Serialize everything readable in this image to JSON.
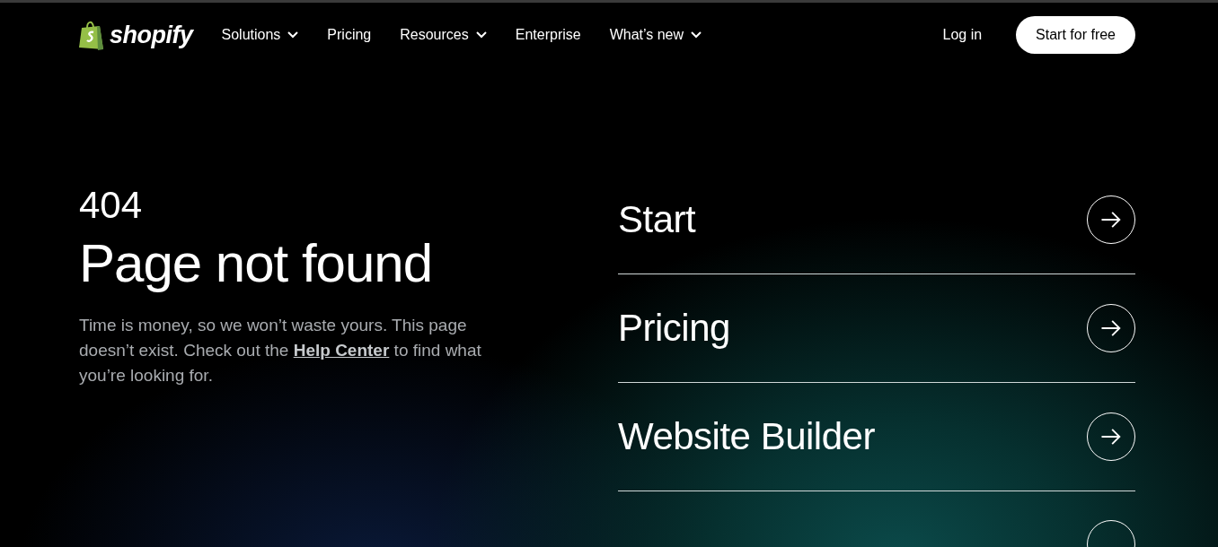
{
  "nav": {
    "logo": "shopify",
    "items": [
      {
        "label": "Solutions",
        "dropdown": true
      },
      {
        "label": "Pricing",
        "dropdown": false
      },
      {
        "label": "Resources",
        "dropdown": true
      },
      {
        "label": "Enterprise",
        "dropdown": false
      },
      {
        "label": "What’s new",
        "dropdown": true
      }
    ],
    "login": "Log in",
    "cta": "Start for free"
  },
  "error": {
    "code": "404",
    "title": "Page not found",
    "message_before": "Time is money, so we won’t waste yours. This page doesn’t exist. Check out the ",
    "link": "Help Center",
    "message_after": " to find what you’re looking for."
  },
  "links": [
    {
      "label": "Start"
    },
    {
      "label": "Pricing"
    },
    {
      "label": "Website Builder"
    }
  ],
  "partial_row": true
}
